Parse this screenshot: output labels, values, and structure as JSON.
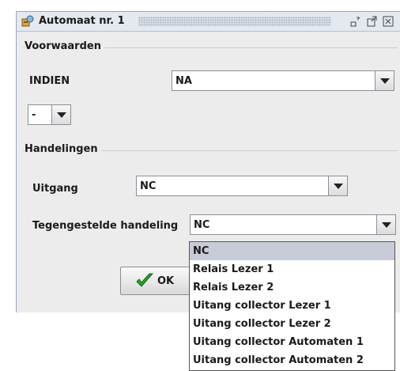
{
  "window": {
    "title": "Automaat nr. 1",
    "buttons": [
      "minimize-icon",
      "maximize-icon",
      "close-icon"
    ]
  },
  "voorwaarden": {
    "group_title": "Voorwaarden",
    "condition_label": "INDIEN",
    "condition_value": "NA",
    "operator_value": "-"
  },
  "handelingen": {
    "group_title": "Handelingen",
    "output_label": "Uitgang",
    "output_value": "NC",
    "opposite_label": "Tegengestelde handeling",
    "opposite_value": "NC"
  },
  "ok_button": {
    "label": "OK"
  },
  "dropdown": {
    "selected_index": 0,
    "options": [
      "NC",
      "Relais  Lezer 1",
      "Relais  Lezer 2",
      "Uitang collector  Lezer 1",
      "Uitang collector  Lezer 2",
      "Uitang collector  Automaten 1",
      "Uitang collector  Automaten 2"
    ]
  }
}
